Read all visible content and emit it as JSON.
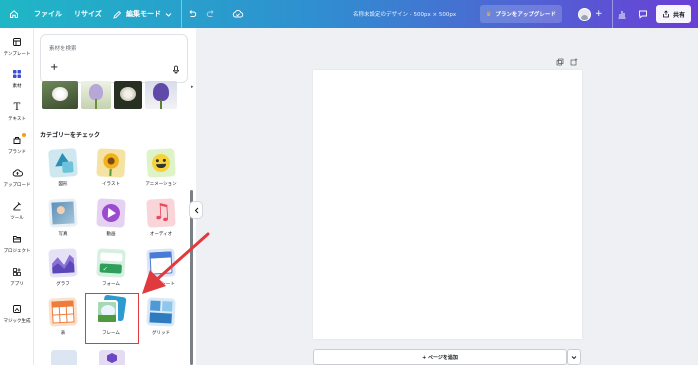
{
  "topbar": {
    "file": "ファイル",
    "resize": "リサイズ",
    "edit_mode": "編集モード",
    "doc_title": "名称未設定のデザイン - 500px × 500px",
    "upgrade": "プランをアップグレード",
    "share": "共有"
  },
  "rail": {
    "items": [
      {
        "label": "テンプレート",
        "icon": "template-icon"
      },
      {
        "label": "素材",
        "icon": "elements-icon"
      },
      {
        "label": "テキスト",
        "icon": "text-icon"
      },
      {
        "label": "ブランド",
        "icon": "brand-icon"
      },
      {
        "label": "アップロード",
        "icon": "upload-icon"
      },
      {
        "label": "ツール",
        "icon": "tools-icon"
      },
      {
        "label": "プロジェクト",
        "icon": "projects-icon"
      },
      {
        "label": "アプリ",
        "icon": "apps-icon"
      },
      {
        "label": "マジック生成",
        "icon": "magic-generate-icon"
      }
    ]
  },
  "panel": {
    "search_placeholder": "素材を検索",
    "categories_title": "カテゴリーをチェック",
    "categories": [
      {
        "label": "図形"
      },
      {
        "label": "イラスト"
      },
      {
        "label": "アニメーション"
      },
      {
        "label": "写真"
      },
      {
        "label": "動画"
      },
      {
        "label": "オーディオ"
      },
      {
        "label": "グラフ"
      },
      {
        "label": "フォーム"
      },
      {
        "label": "Canvaシート"
      },
      {
        "label": "表"
      },
      {
        "label": "フレーム"
      },
      {
        "label": "グリッド"
      }
    ]
  },
  "canvas": {
    "add_page": "+ ページを追加"
  },
  "colors": {
    "highlight_box": "#e0393e",
    "arrow": "#e0393e"
  }
}
